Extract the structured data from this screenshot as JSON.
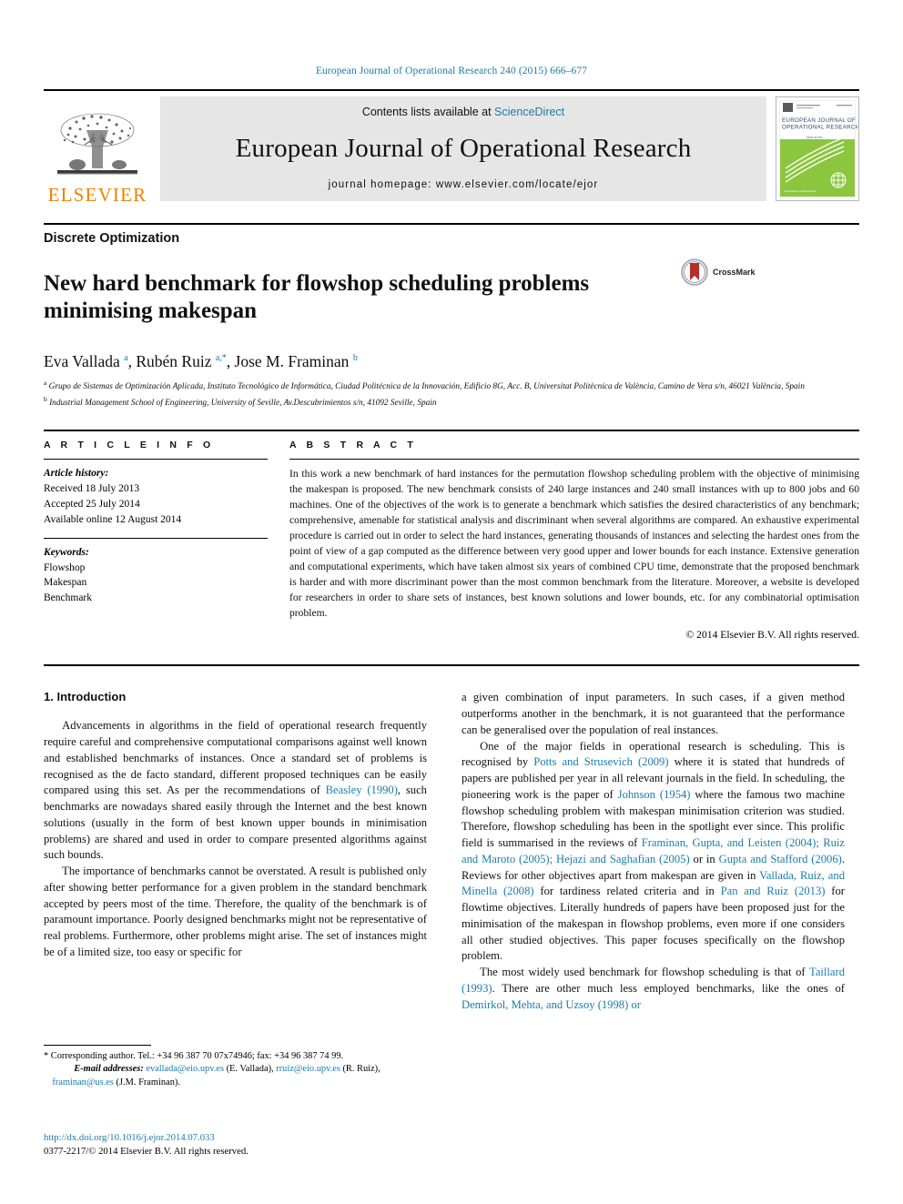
{
  "running_head": "European Journal of Operational Research 240 (2015) 666–677",
  "masthead": {
    "publisher_name": "ELSEVIER",
    "contents_prefix": "Contents lists available at",
    "contents_link": "ScienceDirect",
    "journal_title": "European Journal of Operational Research",
    "homepage": "journal homepage: www.elsevier.com/locate/ejor",
    "cover_line1": "EUROPEAN JOURNAL OF",
    "cover_line2": "OPERATIONAL RESEARCH"
  },
  "section_label": "Discrete Optimization",
  "title": "New hard benchmark for flowshop scheduling problems minimising makespan",
  "crossmark_label": "CrossMark",
  "authors_html": "Eva Vallada <sup>a</sup>, Rubén Ruiz <sup>a,*</sup>, Jose M. Framinan <sup>b</sup>",
  "affiliations": [
    "a Grupo de Sistemas de Optimización Aplicada, Instituto Tecnológico de Informática, Ciudad Politécnica de la Innovación, Edificio 8G, Acc. B, Universitat Politècnica de València, Camino de Vera s/n, 46021 València, Spain",
    "b Industrial Management School of Engineering, University of Seville, Av.Descubrimientos s/n, 41092 Seville, Spain"
  ],
  "article_info": {
    "header": "A R T I C L E   I N F O",
    "history_label": "Article history:",
    "history": [
      "Received 18 July 2013",
      "Accepted 25 July 2014",
      "Available online 12 August 2014"
    ],
    "keywords_label": "Keywords:",
    "keywords": [
      "Flowshop",
      "Makespan",
      "Benchmark"
    ]
  },
  "abstract": {
    "header": "A B S T R A C T",
    "text": "In this work a new benchmark of hard instances for the permutation flowshop scheduling problem with the objective of minimising the makespan is proposed. The new benchmark consists of 240 large instances and 240 small instances with up to 800 jobs and 60 machines. One of the objectives of the work is to generate a benchmark which satisfies the desired characteristics of any benchmark; comprehensive, amenable for statistical analysis and discriminant when several algorithms are compared. An exhaustive experimental procedure is carried out in order to select the hard instances, generating thousands of instances and selecting the hardest ones from the point of view of a gap computed as the difference between very good upper and lower bounds for each instance. Extensive generation and computational experiments, which have taken almost six years of combined CPU time, demonstrate that the proposed benchmark is harder and with more discriminant power than the most common benchmark from the literature. Moreover, a website is developed for researchers in order to share sets of instances, best known solutions and lower bounds, etc. for any combinatorial optimisation problem.",
    "copyright": "© 2014 Elsevier B.V. All rights reserved."
  },
  "body": {
    "intro_heading": "1. Introduction",
    "left_paragraphs": [
      "Advancements in algorithms in the field of operational research frequently require careful and comprehensive computational comparisons against well known and established benchmarks of instances. Once a standard set of problems is recognised as the de facto standard, different proposed techniques can be easily compared using this set. As per the recommendations of <span class=\"lnk\">Beasley (1990)</span>, such benchmarks are nowadays shared easily through the Internet and the best known solutions (usually in the form of best known upper bounds in minimisation problems) are shared and used in order to compare presented algorithms against such bounds.",
      "The importance of benchmarks cannot be overstated. A result is published only after showing better performance for a given problem in the standard benchmark accepted by peers most of the time. Therefore, the quality of the benchmark is of paramount importance. Poorly designed benchmarks might not be representative of real problems. Furthermore, other problems might arise. The set of instances might be of a limited size, too easy or specific for"
    ],
    "right_paragraphs": [
      "a given combination of input parameters. In such cases, if a given method outperforms another in the benchmark, it is not guaranteed that the performance can be generalised over the population of real instances.",
      "One of the major fields in operational research is scheduling. This is recognised by <span class=\"lnk\">Potts and Strusevich (2009)</span> where it is stated that hundreds of papers are published per year in all relevant journals in the field. In scheduling, the pioneering work is the paper of <span class=\"lnk\">Johnson (1954)</span> where the famous two machine flowshop scheduling problem with makespan minimisation criterion was studied. Therefore, flowshop scheduling has been in the spotlight ever since. This prolific field is summarised in the reviews of <span class=\"lnk\">Framinan, Gupta, and Leisten (2004); Ruiz and Maroto (2005); Hejazi and Saghafian (2005)</span> or in <span class=\"lnk\">Gupta and Stafford (2006)</span>. Reviews for other objectives apart from makespan are given in <span class=\"lnk\">Vallada, Ruiz, and Minella (2008)</span> for tardiness related criteria and in <span class=\"lnk\">Pan and Ruiz (2013)</span> for flowtime objectives. Literally hundreds of papers have been proposed just for the minimisation of the makespan in flowshop problems, even more if one considers all other studied objectives. This paper focuses specifically on the flowshop problem.",
      "The most widely used benchmark for flowshop scheduling is that of <span class=\"lnk\">Taillard (1993)</span>. There are other much less employed benchmarks, like the ones of <span class=\"lnk\">Demirkol, Mehta, and Uzsoy (1998) or</span>"
    ]
  },
  "footnote": {
    "corresponding": "* Corresponding author. Tel.: +34 96 387 70 07x74946; fax: +34 96 387 74 99.",
    "email_label": "E-mail addresses:",
    "emails_html": "<span class=\"lnk\">evallada@eio.upv.es</span> (E. Vallada), <span class=\"lnk\">rruiz@eio.upv.es</span> (R. Ruiz), <span class=\"lnk\">framinan@us.es</span> (J.M. Framinan)."
  },
  "doi": {
    "url": "http://dx.doi.org/10.1016/j.ejor.2014.07.033",
    "issn_line": "0377-2217/© 2014 Elsevier B.V. All rights reserved."
  },
  "colors": {
    "link": "#1a7ca8",
    "elsevier_orange": "#f08000",
    "banner_grey": "#e6e6e6",
    "cover_green": "#8cc63f",
    "crossmark_red": "#b5302a"
  }
}
